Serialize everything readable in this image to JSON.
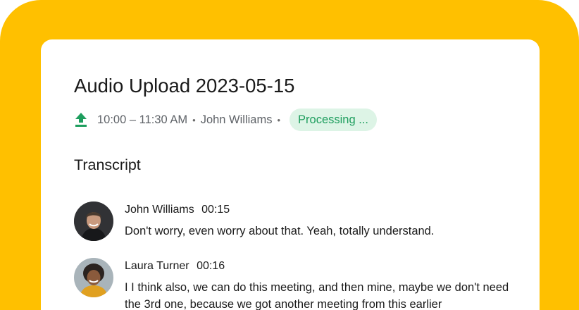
{
  "recording": {
    "title": "Audio Upload 2023-05-15",
    "time_range": "10:00 – 11:30 AM",
    "owner": "John Williams",
    "separator": "•",
    "status": "Processing ...",
    "upload_icon": "upload-icon"
  },
  "transcript": {
    "heading": "Transcript",
    "entries": [
      {
        "speaker": "John Williams",
        "time": "00:15",
        "text": "Don't worry, even worry about that. Yeah, totally understand.",
        "avatar": "avatar-john-williams"
      },
      {
        "speaker": "Laura Turner",
        "time": "00:16",
        "text": "I I think also, we can do this meeting, and then mine, maybe we don't need the 3rd one, because we got another meeting from this earlier",
        "avatar": "avatar-laura-turner"
      }
    ]
  },
  "colors": {
    "frame": "#FFC000",
    "card": "#FFFFFF",
    "accent": "#1E9E5E",
    "status_bg": "#DDF4E6",
    "text": "#1A1A1A",
    "muted": "#5F6368"
  }
}
